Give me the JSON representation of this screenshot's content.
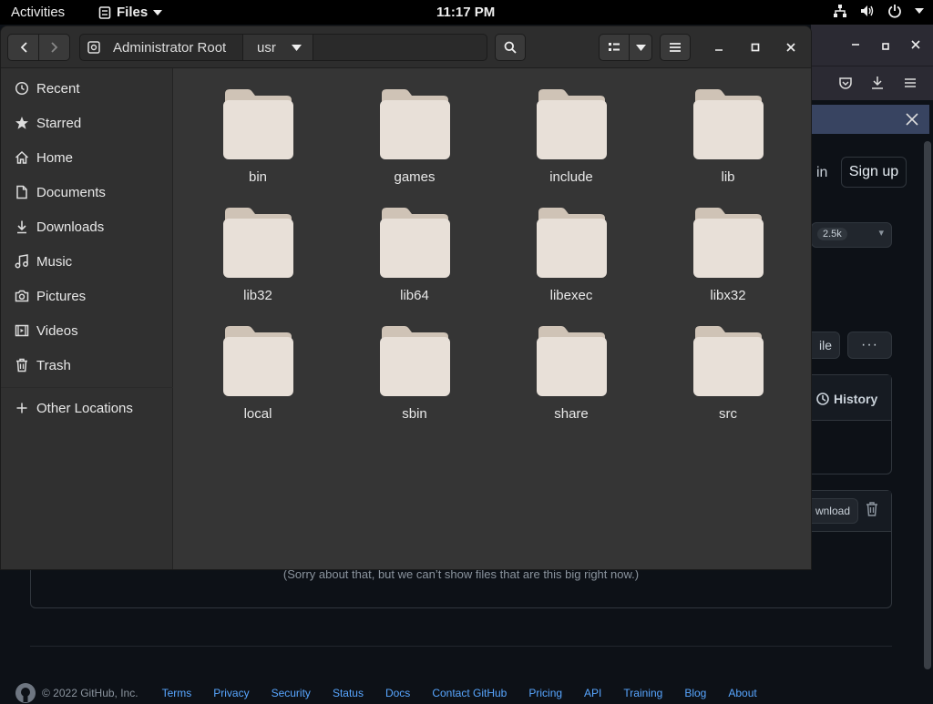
{
  "topbar": {
    "activities": "Activities",
    "app_menu": "Files",
    "clock": "11:17 PM"
  },
  "background_page": {
    "sign_in_partial": "in",
    "sign_up": "Sign up",
    "star_count": "2.5k",
    "file_button_partial": "ile",
    "more_button": "···",
    "history": "History",
    "download_partial": "wnload",
    "too_big_message": "(Sorry about that, but we can’t show files that are this big right now.)",
    "footer": {
      "copyright": "© 2022 GitHub, Inc.",
      "links": [
        "Terms",
        "Privacy",
        "Security",
        "Status",
        "Docs",
        "Contact GitHub",
        "Pricing",
        "API",
        "Training",
        "Blog",
        "About"
      ]
    }
  },
  "file_manager": {
    "path": {
      "root_label": "Administrator Root",
      "current": "usr"
    },
    "sidebar": [
      {
        "label": "Recent",
        "icon": "clock-icon"
      },
      {
        "label": "Starred",
        "icon": "star-icon"
      },
      {
        "label": "Home",
        "icon": "home-icon"
      },
      {
        "label": "Documents",
        "icon": "document-icon"
      },
      {
        "label": "Downloads",
        "icon": "download-icon"
      },
      {
        "label": "Music",
        "icon": "music-icon"
      },
      {
        "label": "Pictures",
        "icon": "camera-icon"
      },
      {
        "label": "Videos",
        "icon": "video-icon"
      },
      {
        "label": "Trash",
        "icon": "trash-icon"
      }
    ],
    "other_locations": "Other Locations",
    "folders": [
      "bin",
      "games",
      "include",
      "lib",
      "lib32",
      "lib64",
      "libexec",
      "libx32",
      "local",
      "sbin",
      "share",
      "src"
    ]
  },
  "colors": {
    "folder_body": "#e8e0d8",
    "folder_tab": "#cfc3b6",
    "window_bg": "#353535",
    "sidebar_bg": "#303030",
    "github_bg": "#0d1117",
    "link_blue": "#58a6ff"
  }
}
